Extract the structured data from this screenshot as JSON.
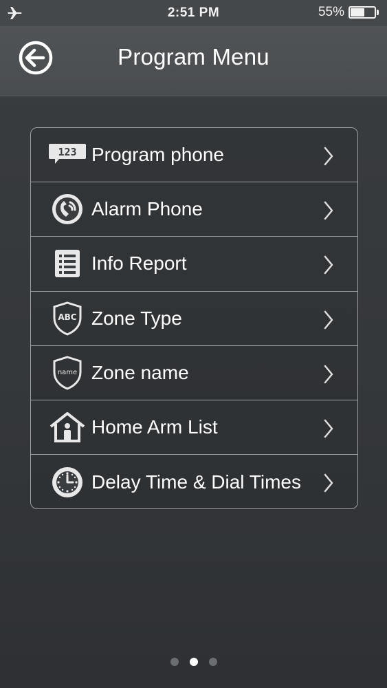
{
  "status_bar": {
    "time": "2:51 PM",
    "battery_percent": "55%",
    "battery_level": 0.55,
    "airplane_icon": "airplane-icon"
  },
  "nav": {
    "title": "Program Menu",
    "back_icon": "circle-arrow-left-icon"
  },
  "menu": {
    "items": [
      {
        "label": "Program phone",
        "icon": "speech-bubble-123-icon",
        "icon_text": "123"
      },
      {
        "label": "Alarm Phone",
        "icon": "alarm-phone-icon"
      },
      {
        "label": "Info Report",
        "icon": "list-report-icon"
      },
      {
        "label": "Zone Type",
        "icon": "shield-abc-icon",
        "icon_text": "ABC"
      },
      {
        "label": "Zone name",
        "icon": "shield-name-icon",
        "icon_text": "name"
      },
      {
        "label": "Home Arm List",
        "icon": "home-person-icon"
      },
      {
        "label": "Delay Time & Dial Times",
        "icon": "clock-icon"
      }
    ]
  },
  "pagination": {
    "total": 3,
    "active_index": 1
  }
}
